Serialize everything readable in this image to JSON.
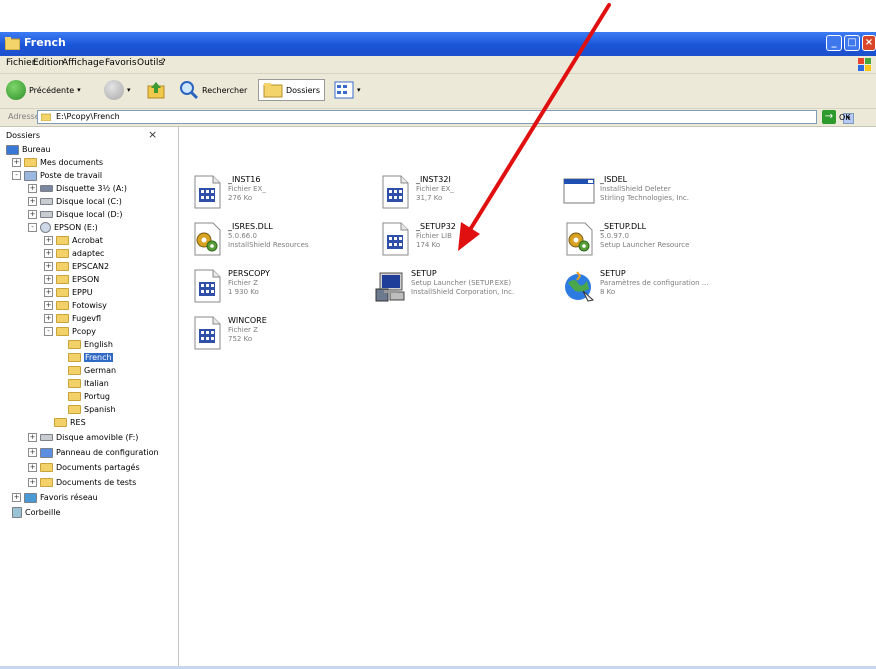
{
  "window": {
    "title": "French"
  },
  "menu": [
    "Fichier",
    "Edition",
    "Affichage",
    "Favoris",
    "Outils",
    "?"
  ],
  "toolbar": {
    "back": "Précédente",
    "search": "Rechercher",
    "folders": "Dossiers"
  },
  "address": {
    "label": "Adresse",
    "path": "E:\\Pcopy\\French",
    "go": "OK"
  },
  "folder_pane": {
    "title": "Dossiers",
    "tree": [
      {
        "label": "Bureau",
        "icon": "desktop"
      },
      {
        "label": "Mes documents",
        "icon": "folder"
      },
      {
        "label": "Poste de travail",
        "icon": "computer"
      },
      {
        "label": "Disquette 3½ (A:)",
        "icon": "floppy"
      },
      {
        "label": "Disque local (C:)",
        "icon": "drive"
      },
      {
        "label": "Disque local (D:)",
        "icon": "drive"
      },
      {
        "label": "EPSON (E:)",
        "icon": "cd"
      },
      {
        "label": "Acrobat",
        "icon": "folder"
      },
      {
        "label": "adaptec",
        "icon": "folder"
      },
      {
        "label": "EPSCAN2",
        "icon": "folder"
      },
      {
        "label": "EPSON",
        "icon": "folder"
      },
      {
        "label": "EPPU",
        "icon": "folder"
      },
      {
        "label": "Fotowisy",
        "icon": "folder"
      },
      {
        "label": "Fugevfl",
        "icon": "folder"
      },
      {
        "label": "Pcopy",
        "icon": "folder"
      },
      {
        "label": "English",
        "icon": "folder"
      },
      {
        "label": "French",
        "icon": "folder",
        "selected": true
      },
      {
        "label": "German",
        "icon": "folder"
      },
      {
        "label": "Italian",
        "icon": "folder"
      },
      {
        "label": "Portug",
        "icon": "folder"
      },
      {
        "label": "Spanish",
        "icon": "folder"
      },
      {
        "label": "RES",
        "icon": "folder"
      },
      {
        "label": "Disque amovible (F:)",
        "icon": "drive"
      },
      {
        "label": "Panneau de configuration",
        "icon": "control-panel"
      },
      {
        "label": "Documents partagés",
        "icon": "folder"
      },
      {
        "label": "Documents de tests",
        "icon": "folder"
      },
      {
        "label": "Favoris réseau",
        "icon": "network"
      },
      {
        "label": "Corbeille",
        "icon": "recycle-bin"
      }
    ]
  },
  "files": [
    {
      "name": "_INST16",
      "line1": "Fichier EX_",
      "line2": "276 Ko",
      "icon": "generic-file"
    },
    {
      "name": "_INST32I",
      "line1": "Fichier EX_",
      "line2": "31,7 Ko",
      "icon": "generic-file"
    },
    {
      "name": "_ISDEL",
      "line1": "InstallShield Deleter",
      "line2": "Stirling Technologies, Inc.",
      "icon": "window-app"
    },
    {
      "name": "_ISRES.DLL",
      "line1": "5.0.66.0",
      "line2": "InstallShield Resources",
      "icon": "dll"
    },
    {
      "name": "_SETUP32",
      "line1": "Fichier LIB",
      "line2": "174 Ko",
      "icon": "generic-file"
    },
    {
      "name": "_SETUP.DLL",
      "line1": "5.0.97.0",
      "line2": "Setup Launcher Resource",
      "icon": "dll"
    },
    {
      "name": "PERSCOPY",
      "line1": "Fichier Z",
      "line2": "1 930 Ko",
      "icon": "generic-file"
    },
    {
      "name": "SETUP",
      "line1": "Setup Launcher (SETUP.EXE)",
      "line2": "InstallShield Corporation, Inc.",
      "icon": "setup-computer"
    },
    {
      "name": "SETUP",
      "line1": "Paramètres de configuration ...",
      "line2": "8 Ko",
      "icon": "setup-globe"
    },
    {
      "name": "WINCORE",
      "line1": "Fichier Z",
      "line2": "752 Ko",
      "icon": "generic-file"
    }
  ],
  "colors": {
    "title_bar": "#1d56d6",
    "selection": "#316ac5",
    "arrow": "#e01010"
  }
}
